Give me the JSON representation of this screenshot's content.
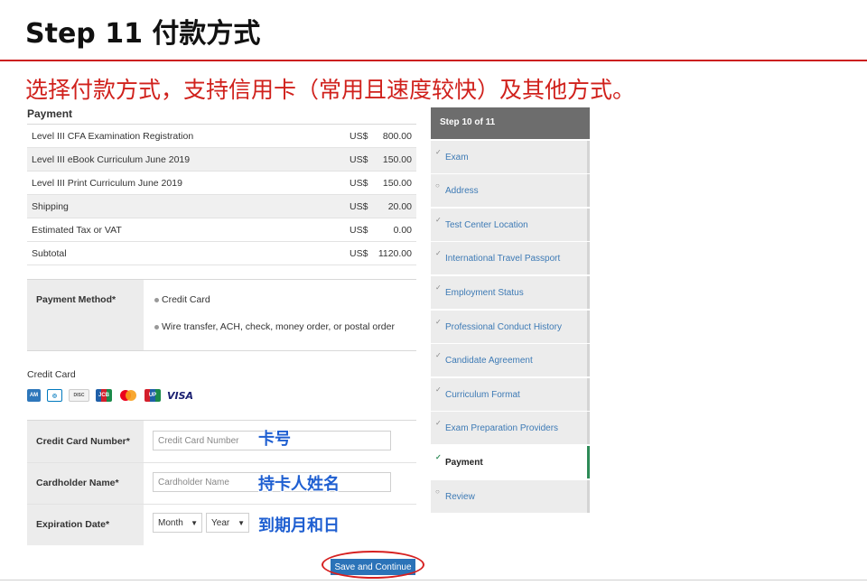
{
  "slide": {
    "title": "Step 11 付款方式",
    "subtitle": "选择付款方式，支持信用卡（常用且速度较快）及其他方式。"
  },
  "payment": {
    "heading": "Payment",
    "rows": [
      {
        "desc": "Level III CFA Examination Registration",
        "currency": "US$",
        "amount": "800.00"
      },
      {
        "desc": "Level III eBook Curriculum June 2019",
        "currency": "US$",
        "amount": "150.00"
      },
      {
        "desc": "Level III Print Curriculum June 2019",
        "currency": "US$",
        "amount": "150.00"
      },
      {
        "desc": "Shipping",
        "currency": "US$",
        "amount": "20.00"
      },
      {
        "desc": "Estimated Tax or VAT",
        "currency": "US$",
        "amount": "0.00"
      },
      {
        "desc": "Subtotal",
        "currency": "US$",
        "amount": "1120.00"
      }
    ]
  },
  "payment_method": {
    "label": "Payment Method*",
    "options": [
      "Credit Card",
      "Wire transfer, ACH, check, money order, or postal order"
    ]
  },
  "credit_card": {
    "heading": "Credit Card",
    "logos": [
      "amex-logo",
      "diners-logo",
      "discover-logo",
      "jcb-logo",
      "mastercard-logo",
      "unionpay-logo",
      "visa-logo"
    ],
    "visa_text": "VISA",
    "number_label": "Credit Card Number*",
    "number_placeholder": "Credit Card Number",
    "number_annotation": "卡号",
    "name_label": "Cardholder Name*",
    "name_placeholder": "Cardholder Name",
    "name_annotation": "持卡人姓名",
    "expiry_label": "Expiration Date*",
    "month_value": "Month",
    "year_value": "Year",
    "expiry_annotation": "到期月和日"
  },
  "actions": {
    "submit_label": "Save and Continue"
  },
  "steps": {
    "header": "Step 10 of 11",
    "items": [
      {
        "label": "Exam"
      },
      {
        "label": "Address"
      },
      {
        "label": "Test Center Location"
      },
      {
        "label": "International Travel Passport"
      },
      {
        "label": "Employment Status"
      },
      {
        "label": "Professional Conduct History"
      },
      {
        "label": "Candidate Agreement"
      },
      {
        "label": "Curriculum Format"
      },
      {
        "label": "Exam Preparation Providers"
      },
      {
        "label": "Payment"
      },
      {
        "label": "Review"
      }
    ],
    "active_index": 9
  },
  "colors": {
    "accent_red": "#d0211c",
    "link_blue": "#3d7ab5",
    "button_blue": "#2b73b8",
    "annotation_blue": "#1f5fd1",
    "active_step": "#2e8b57"
  }
}
